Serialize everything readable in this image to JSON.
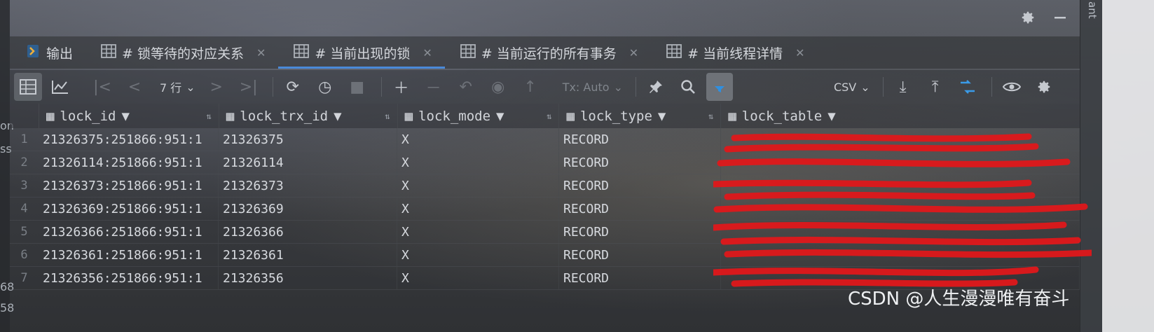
{
  "tabs": [
    {
      "label": "输出",
      "icon": "output-icon",
      "active": false,
      "closable": false
    },
    {
      "label": "# 锁等待的对应关系",
      "icon": "table-icon",
      "active": false,
      "closable": true
    },
    {
      "label": "# 当前出现的锁",
      "icon": "table-icon",
      "active": true,
      "closable": true
    },
    {
      "label": "# 当前运行的所有事务",
      "icon": "table-icon",
      "active": false,
      "closable": true
    },
    {
      "label": "# 当前线程详情",
      "icon": "table-icon",
      "active": false,
      "closable": true
    }
  ],
  "toolbar": {
    "row_count": "7 行",
    "tx_mode": "Tx: Auto",
    "export_format": "CSV"
  },
  "columns": [
    {
      "name": "lock_id"
    },
    {
      "name": "lock_trx_id"
    },
    {
      "name": "lock_mode"
    },
    {
      "name": "lock_type"
    },
    {
      "name": "lock_table"
    }
  ],
  "rows": [
    {
      "n": "1",
      "lock_id": "21326375:251866:951:1",
      "lock_trx_id": "21326375",
      "lock_mode": "X",
      "lock_type": "RECORD"
    },
    {
      "n": "2",
      "lock_id": "21326114:251866:951:1",
      "lock_trx_id": "21326114",
      "lock_mode": "X",
      "lock_type": "RECORD"
    },
    {
      "n": "3",
      "lock_id": "21326373:251866:951:1",
      "lock_trx_id": "21326373",
      "lock_mode": "X",
      "lock_type": "RECORD"
    },
    {
      "n": "4",
      "lock_id": "21326369:251866:951:1",
      "lock_trx_id": "21326369",
      "lock_mode": "X",
      "lock_type": "RECORD"
    },
    {
      "n": "5",
      "lock_id": "21326366:251866:951:1",
      "lock_trx_id": "21326366",
      "lock_mode": "X",
      "lock_type": "RECORD"
    },
    {
      "n": "6",
      "lock_id": "21326361:251866:951:1",
      "lock_trx_id": "21326361",
      "lock_mode": "X",
      "lock_type": "RECORD"
    },
    {
      "n": "7",
      "lock_id": "21326356:251866:951:1",
      "lock_trx_id": "21326356",
      "lock_mode": "X",
      "lock_type": "RECORD"
    }
  ],
  "side_fragments": {
    "left": [
      "on",
      "ss",
      "68",
      "58"
    ],
    "right": [
      "ant"
    ]
  },
  "watermark": "CSDN @人生漫漫唯有奋斗",
  "colors": {
    "accent": "#4a8ad9",
    "redaction": "#e0181b"
  }
}
